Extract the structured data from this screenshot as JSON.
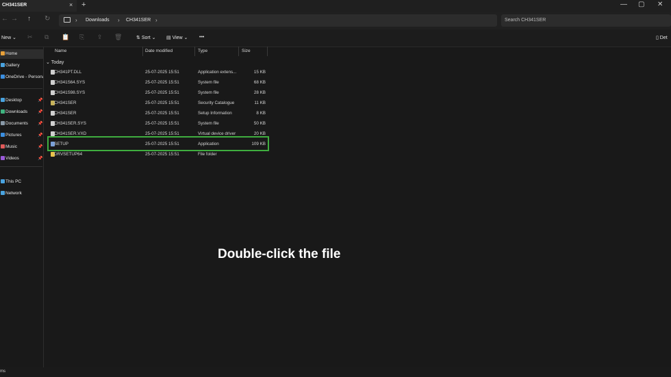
{
  "window": {
    "tab_title": "CH341SER",
    "tab_close": "×",
    "new_tab": "+",
    "controls": [
      "—",
      "▢",
      "✕"
    ]
  },
  "address_bar": {
    "nav": [
      "←",
      "→",
      "↑",
      "↻"
    ],
    "crumbs": [
      "Downloads",
      "CH341SER"
    ],
    "chevron": "›",
    "search_placeholder": "Search CH341SER"
  },
  "toolbar": {
    "new_label": "New",
    "dim_icons": [
      "✂",
      "⧉",
      "📋",
      "⎘",
      "🗑"
    ],
    "sort_label": "Sort",
    "view_label": "View",
    "more_label": "•••",
    "details_label": "Det"
  },
  "sidebar": {
    "items": [
      {
        "label": "Home",
        "color": "#e8a13a",
        "pinned": false,
        "selected": true
      },
      {
        "label": "Gallery",
        "color": "#4aa3df",
        "pinned": false,
        "selected": false
      },
      {
        "label": "OneDrive - Persona",
        "color": "#3c8fe0",
        "pinned": false,
        "selected": false
      },
      {
        "label": "Desktop",
        "color": "#4aa3df",
        "pinned": true,
        "selected": false
      },
      {
        "label": "Downloads",
        "color": "#3fb37f",
        "pinned": true,
        "selected": false
      },
      {
        "label": "Documents",
        "color": "#8a9aa8",
        "pinned": true,
        "selected": false
      },
      {
        "label": "Pictures",
        "color": "#3c8fe0",
        "pinned": true,
        "selected": false
      },
      {
        "label": "Music",
        "color": "#e05a5a",
        "pinned": true,
        "selected": false
      },
      {
        "label": "Videos",
        "color": "#9a5ad8",
        "pinned": true,
        "selected": false
      },
      {
        "label": "This PC",
        "color": "#4aa3df",
        "pinned": false,
        "selected": false
      },
      {
        "label": "Network",
        "color": "#4aa3df",
        "pinned": false,
        "selected": false
      }
    ],
    "pin_glyph": "📌"
  },
  "file_list": {
    "columns": [
      "Name",
      "Date modified",
      "Type",
      "Size"
    ],
    "group_label": "Today",
    "group_chevron": "⌄",
    "rows": [
      {
        "name": "CH341PT.DLL",
        "date": "25-07-2025 15:51",
        "type": "Application extens...",
        "size": "15 KB",
        "icon_color": "#d0d0d0"
      },
      {
        "name": "CH341S64.SYS",
        "date": "25-07-2025 15:51",
        "type": "System file",
        "size": "68 KB",
        "icon_color": "#d0d0d0"
      },
      {
        "name": "CH341S98.SYS",
        "date": "25-07-2025 15:51",
        "type": "System file",
        "size": "28 KB",
        "icon_color": "#d0d0d0"
      },
      {
        "name": "CH341SER",
        "date": "25-07-2025 15:51",
        "type": "Security Catalogue",
        "size": "11 KB",
        "icon_color": "#c7b35a"
      },
      {
        "name": "CH341SER",
        "date": "25-07-2025 15:51",
        "type": "Setup Information",
        "size": "8 KB",
        "icon_color": "#d0d0d0"
      },
      {
        "name": "CH341SER.SYS",
        "date": "25-07-2025 15:51",
        "type": "System file",
        "size": "50 KB",
        "icon_color": "#d0d0d0"
      },
      {
        "name": "CH341SER.VXD",
        "date": "25-07-2025 15:51",
        "type": "Virtual device driver",
        "size": "20 KB",
        "icon_color": "#d0d0d0"
      },
      {
        "name": "SETUP",
        "date": "25-07-2025 15:51",
        "type": "Application",
        "size": "109 KB",
        "icon_color": "#7aa0d8"
      },
      {
        "name": "DRVSETUP64",
        "date": "25-07-2025 15:51",
        "type": "File folder",
        "size": "",
        "icon_color": "#e8c24a"
      }
    ]
  },
  "overlay": {
    "caption": "Double-click the file",
    "highlight_color": "#3fae3f"
  },
  "statusbar": {
    "text": "ms"
  }
}
